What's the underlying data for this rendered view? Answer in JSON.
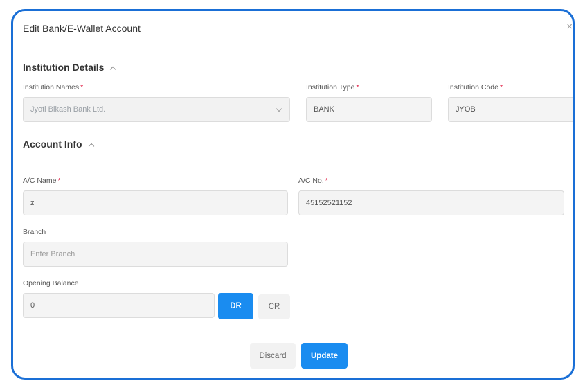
{
  "modal": {
    "title": "Edit Bank/E-Wallet Account",
    "close_glyph": "×"
  },
  "institution": {
    "section_title": "Institution Details",
    "names_label": "Institution Names",
    "names_value": "Jyoti Bikash Bank Ltd.",
    "type_label": "Institution Type",
    "type_value": "BANK",
    "code_label": "Institution Code",
    "code_value": "JYOB"
  },
  "account": {
    "section_title": "Account Info",
    "ac_name_label": "A/C Name",
    "ac_name_value": "z",
    "ac_no_label": "A/C No.",
    "ac_no_value": "45152521152",
    "branch_label": "Branch",
    "branch_placeholder": "Enter Branch",
    "opening_label": "Opening Balance",
    "opening_value": "0",
    "dr_label": "DR",
    "cr_label": "CR"
  },
  "actions": {
    "discard_label": "Discard",
    "update_label": "Update"
  },
  "required_marker": "*",
  "colors": {
    "frame_border": "#1a6fd6",
    "primary": "#1a8cf0",
    "required": "#e0143c"
  }
}
